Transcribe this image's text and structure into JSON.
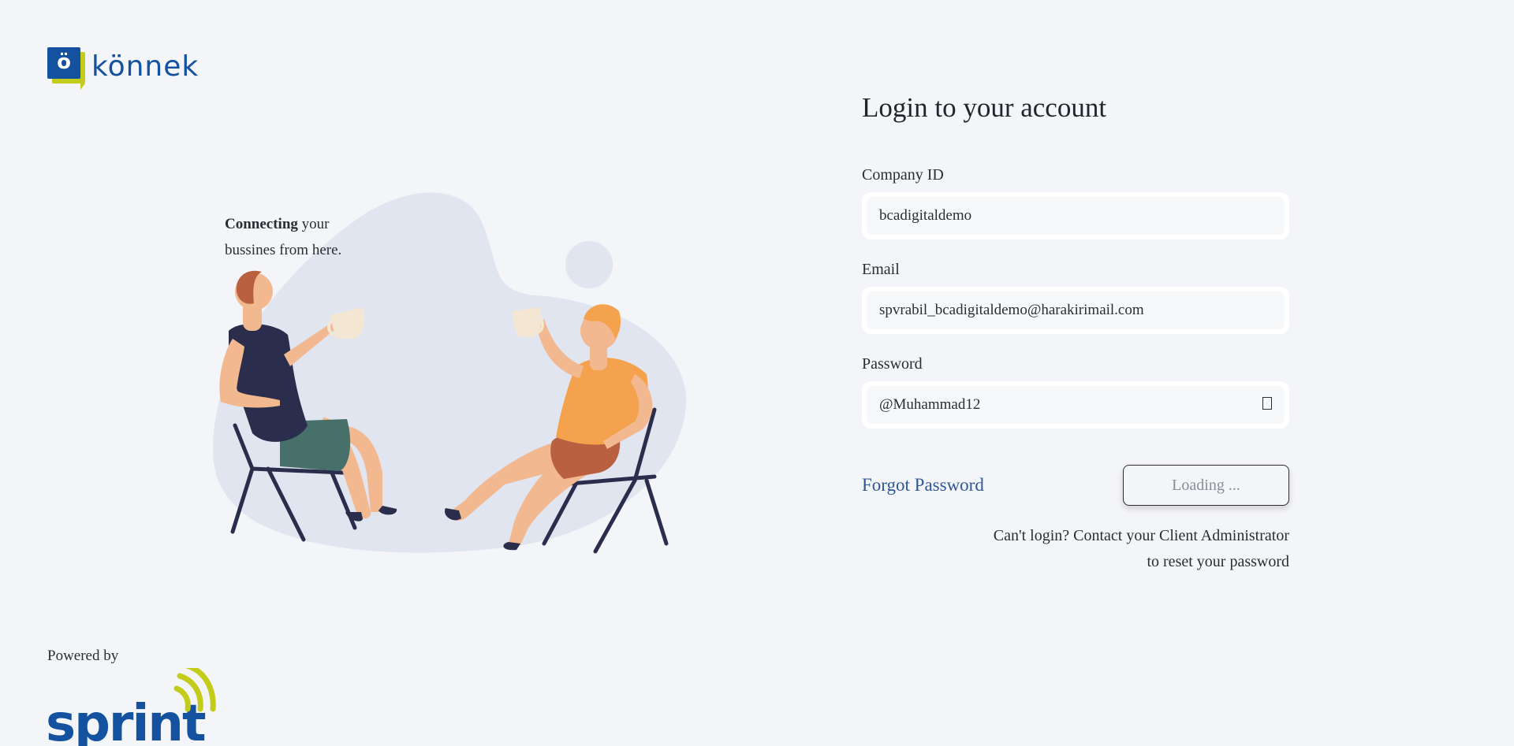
{
  "brand": {
    "logo_glyph": "ö",
    "logo_text": "könnek",
    "primary_color": "#1452a0",
    "accent_color": "#c3cc1a"
  },
  "hero": {
    "tagline_bold": "Connecting",
    "tagline_rest_1": " your",
    "tagline_line_2": "bussines from here."
  },
  "footer": {
    "powered_by": "Powered by",
    "partner_logo_text": "sprint"
  },
  "form": {
    "title": "Login to your account",
    "company_id": {
      "label": "Company ID",
      "value": "bcadigitaldemo"
    },
    "email": {
      "label": "Email",
      "value": "spvrabil_bcadigitaldemo@harakirimail.com"
    },
    "password": {
      "label": "Password",
      "value": "@Muhammad12",
      "toggle_icon": "eye-icon"
    },
    "forgot_password": "Forgot Password",
    "submit_label": "Loading ...",
    "help_line_1": "Can't login? Contact your Client Administrator",
    "help_line_2": "to reset your password"
  }
}
